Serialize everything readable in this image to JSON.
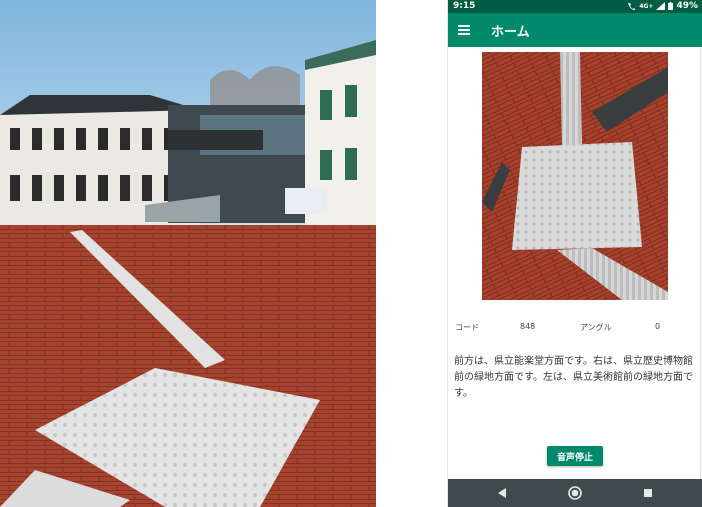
{
  "status_bar": {
    "time": "9:15",
    "network": "4G+",
    "battery": "49%"
  },
  "app_bar": {
    "title": "ホーム",
    "menu_icon": "hamburger-menu-icon"
  },
  "info": {
    "code_label": "コード",
    "code_value": "848",
    "angle_label": "アングル",
    "angle_value": "0"
  },
  "description": "前方は、県立能楽堂方面です。右は、県立歴史博物館前の緑地方面です。左は、県立美術館前の緑地方面です。",
  "stop_button": "音声停止",
  "nav": {
    "back_icon": "back-triangle-icon",
    "home_icon": "home-circle-icon",
    "recent_icon": "recent-apps-square-icon"
  },
  "colors": {
    "primary": "#00896b",
    "status_bar": "#005c43",
    "nav_bar": "#3f4a4c",
    "brick": "#a6432f"
  }
}
